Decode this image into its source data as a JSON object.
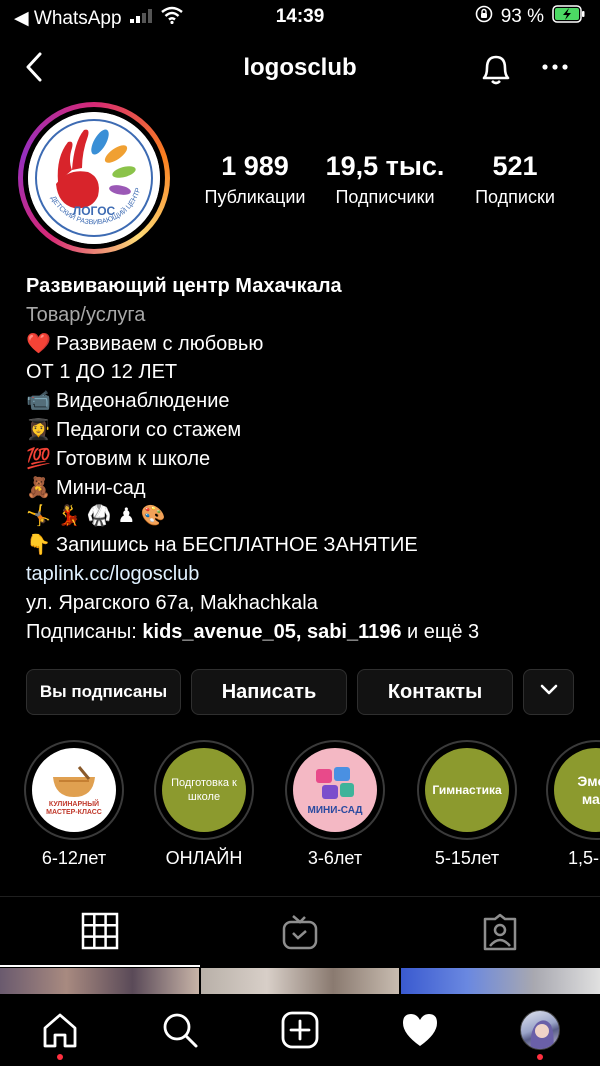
{
  "status_bar": {
    "back_app": "◀ WhatsApp",
    "time": "14:39",
    "battery_percent": "93 %"
  },
  "header": {
    "username": "logosclub"
  },
  "profile": {
    "avatar_logo_text": "ЛОГОС",
    "avatar_ring_text": "ДЕТСКИЙ РАЗВИВАЮЩИЙ ЦЕНТР",
    "stats": [
      {
        "value": "1 989",
        "label": "Публикации"
      },
      {
        "value": "19,5 тыс.",
        "label": "Подписчики"
      },
      {
        "value": "521",
        "label": "Подписки"
      }
    ]
  },
  "bio": {
    "name": "Развивающий центр Махачкала",
    "category": "Товар/услуга",
    "lines": [
      {
        "emoji": "❤️",
        "text": "Развиваем с любовью"
      },
      {
        "emoji": "",
        "text": "ОТ 1 ДО 12 ЛЕТ"
      },
      {
        "emoji": "📹",
        "text": "Видеонаблюдение"
      },
      {
        "emoji": "👩‍🎓",
        "text": "Педагоги со стажем"
      },
      {
        "emoji": "💯",
        "text": "Готовим к школе"
      },
      {
        "emoji": "🧸",
        "text": "Мини-сад"
      },
      {
        "emoji": "🤸 💃 🥋 ♟ 🎨",
        "text": ""
      },
      {
        "emoji": "👇",
        "text": "Запишись на БЕСПЛАТНОЕ ЗАНЯТИЕ"
      }
    ],
    "link": "taplink.cc/logosclub",
    "address": " ул. Ярагского 67а, Makhachkala",
    "followed_by_prefix": "Подписаны: ",
    "followed_by_names": "kids_avenue_05, sabi_1196",
    "followed_by_suffix": " и ещё 3"
  },
  "buttons": {
    "following": "Вы подписаны",
    "message": "Написать",
    "contacts": "Контакты"
  },
  "highlights": [
    {
      "label": "6-12лет",
      "cover_text": "КУЛИНАРНЫЙ МАСТЕР-КЛАСС",
      "bg": "#ffffff",
      "fg": "#c0392b"
    },
    {
      "label": "ОНЛАЙН",
      "cover_text": "Подготовка к школе",
      "bg": "#8c9a2e",
      "fg": "#ffffff"
    },
    {
      "label": "3-6лет",
      "cover_text": "МИНИ-САД",
      "bg": "#f4b8c4",
      "fg": "#2a4aa0"
    },
    {
      "label": "5-15лет",
      "cover_text": "Гимнастика",
      "bg": "#8c9a2e",
      "fg": "#ffffff"
    },
    {
      "label": "1,5-",
      "cover_text": "Эмоц мам",
      "bg": "#8c9a2e",
      "fg": "#ffffff"
    }
  ],
  "colors": {
    "background": "#000000",
    "button_bg": "#121212",
    "muted_text": "#a8a8a8",
    "notification_dot": "#ff3040"
  },
  "icons": {
    "back": "chevron-left-icon",
    "bell": "bell-icon",
    "more": "more-horizontal-icon",
    "grid_tab": "grid-icon",
    "igtv_tab": "igtv-icon",
    "tagged_tab": "tagged-icon",
    "home": "home-icon",
    "search": "search-icon",
    "new_post": "plus-square-icon",
    "activity": "heart-icon",
    "profile": "profile-avatar"
  }
}
